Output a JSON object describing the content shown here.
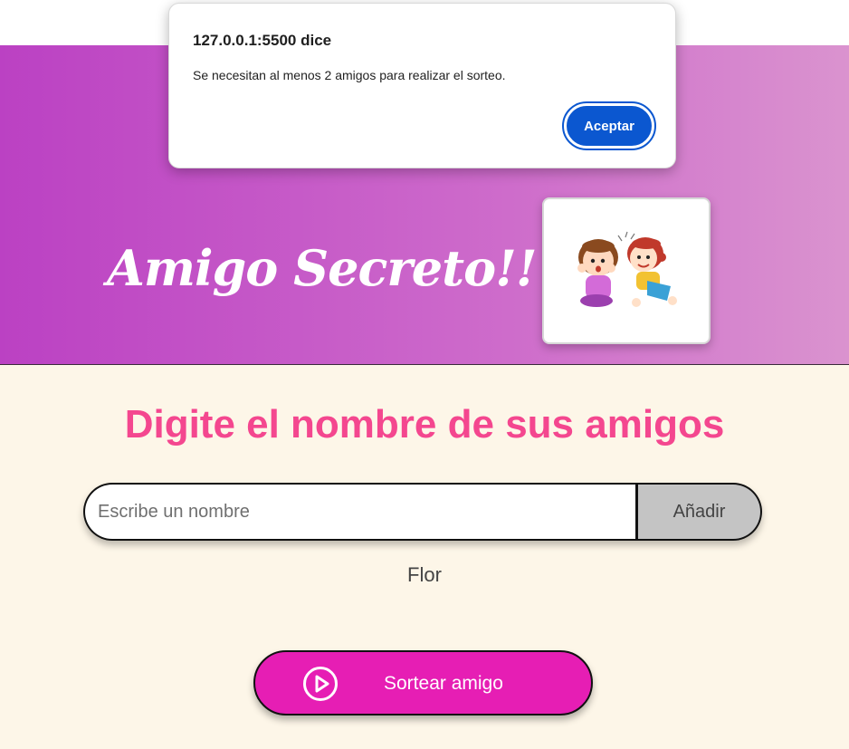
{
  "dialog": {
    "title": "127.0.0.1:5500 dice",
    "message": "Se necesitan al menos 2 amigos para realizar el sorteo.",
    "ok_label": "Aceptar"
  },
  "header": {
    "title": "Amigo Secreto!!"
  },
  "main": {
    "section_title": "Digite el nombre de sus amigos",
    "name_input": {
      "placeholder": "Escribe un nombre",
      "value": ""
    },
    "add_label": "Añadir",
    "friends": [
      "Flor"
    ],
    "draw_label": "Sortear amigo"
  },
  "colors": {
    "header_gradient_start": "#bb41c3",
    "header_gradient_end": "#da93cf",
    "page_background": "#fdf6e8",
    "section_title": "#f4478f",
    "draw_button": "#e61eb4",
    "add_button": "#c4c4c4",
    "dialog_button": "#0b57d0"
  },
  "icons": {
    "header_image": "two-girls-whispering-illustration",
    "draw_button_icon": "play-circle-icon"
  }
}
